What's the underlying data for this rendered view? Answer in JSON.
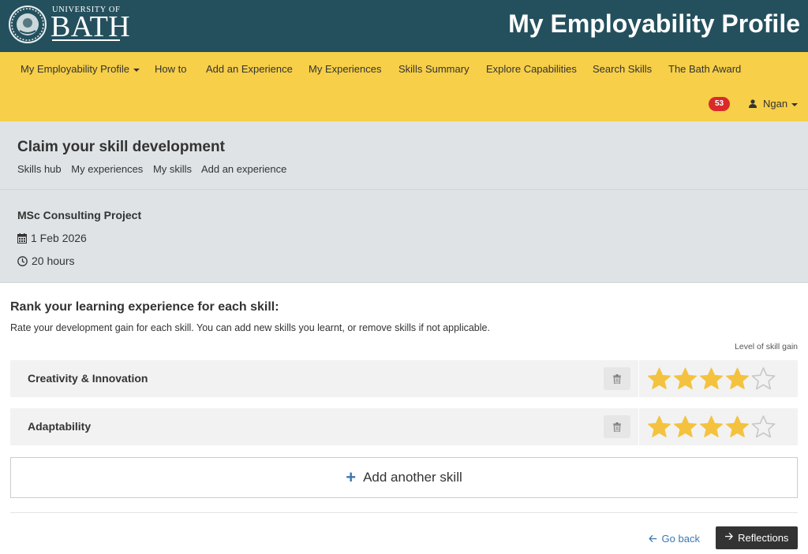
{
  "header": {
    "logo_small": "UNIVERSITY OF",
    "logo_big": "BATH",
    "app_title": "My Employability Profile"
  },
  "nav": {
    "items": [
      {
        "label": "My Employability Profile",
        "has_caret": true
      },
      {
        "label": "How to"
      },
      {
        "label": "Add an Experience"
      },
      {
        "label": "My Experiences"
      },
      {
        "label": "Skills Summary"
      },
      {
        "label": "Explore Capabilities"
      },
      {
        "label": "Search Skills"
      },
      {
        "label": "The Bath Award"
      }
    ],
    "notification_count": "53",
    "user_name": "Ngan"
  },
  "page": {
    "title": "Claim your skill development",
    "breadcrumbs": [
      "Skills hub",
      "My experiences",
      "My skills",
      "Add an experience"
    ]
  },
  "experience": {
    "name": "MSc Consulting Project",
    "date": "1 Feb 2026",
    "duration": "20 hours"
  },
  "rank": {
    "title": "Rank your learning experience for each skill:",
    "description": "Rate your development gain for each skill. You can add new skills you learnt, or remove skills if not applicable.",
    "level_label": "Level of skill gain"
  },
  "skills": [
    {
      "name": "Creativity & Innovation",
      "rating": 4,
      "max_rating": 5
    },
    {
      "name": "Adaptability",
      "rating": 4,
      "max_rating": 5
    }
  ],
  "actions": {
    "add_skill": "Add another skill",
    "go_back": "Go back",
    "reflections": "Reflections"
  },
  "colors": {
    "header_bg": "#24505d",
    "nav_bg": "#f7cf48",
    "panel_bg": "#dfe3e6",
    "star_filled": "#f4c23e",
    "link": "#3a78b0",
    "badge": "#d92a2a"
  },
  "icons": {
    "calendar": "calendar-icon",
    "clock": "clock-icon",
    "trash": "trash-icon",
    "user": "user-icon",
    "star": "star-icon",
    "plus": "plus-icon",
    "arrow_left": "arrow-left-icon",
    "arrow_right": "arrow-right-icon"
  }
}
